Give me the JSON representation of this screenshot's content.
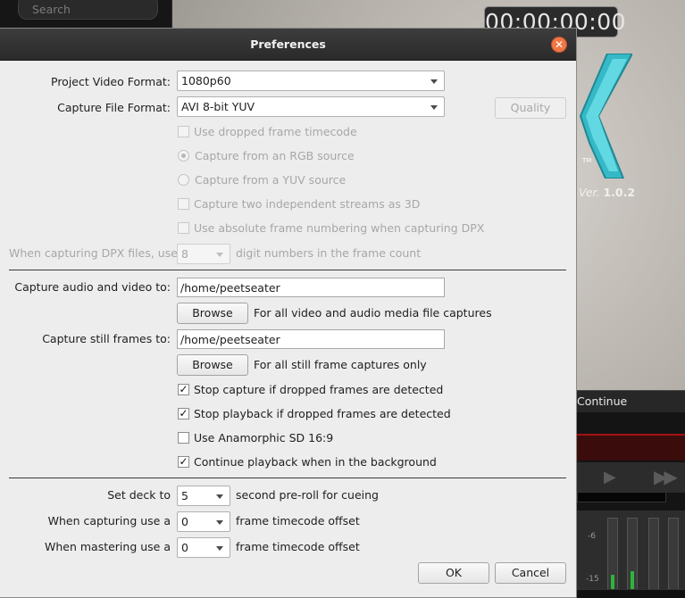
{
  "background": {
    "search_placeholder": "Search",
    "timecode": "00:00:00:00",
    "version_prefix": "Ver.",
    "version_number": "1.0.2",
    "continue_label": "Continue",
    "meter_labels": [
      "-6",
      "-15"
    ],
    "accent": "#a41313",
    "meter_fill_levels": [
      0.28,
      0.33
    ]
  },
  "dialog": {
    "title": "Preferences",
    "close_icon": "close-icon",
    "accent": "#f07746",
    "project_video_format": {
      "label": "Project Video Format:",
      "value": "1080p60"
    },
    "capture_file_format": {
      "label": "Capture File Format:",
      "value": "AVI 8-bit YUV"
    },
    "quality_button": "Quality",
    "capture_options": [
      {
        "type": "checkbox",
        "label": "Use dropped frame timecode",
        "checked": false,
        "enabled": false
      },
      {
        "type": "radio",
        "label": "Capture from an RGB source",
        "checked": true,
        "enabled": false
      },
      {
        "type": "radio",
        "label": "Capture from a YUV source",
        "checked": false,
        "enabled": false
      },
      {
        "type": "checkbox",
        "label": "Capture two independent streams as 3D",
        "checked": false,
        "enabled": false
      },
      {
        "type": "checkbox",
        "label": "Use absolute frame numbering when capturing DPX",
        "checked": false,
        "enabled": false
      }
    ],
    "dpx_digits": {
      "label": "When capturing DPX files, use",
      "value": "8",
      "suffix": "digit numbers in the frame count"
    },
    "capture_av": {
      "label": "Capture audio and video to:",
      "value": "/home/peetseater",
      "browse": "Browse",
      "hint": "For all video and audio media file captures"
    },
    "capture_still": {
      "label": "Capture still frames to:",
      "value": "/home/peetseater",
      "browse": "Browse",
      "hint": "For all still frame captures only"
    },
    "general_options": [
      {
        "label": "Stop capture if dropped frames are detected",
        "checked": true
      },
      {
        "label": "Stop playback if dropped frames are detected",
        "checked": true
      },
      {
        "label": "Use Anamorphic SD 16:9",
        "checked": false
      },
      {
        "label": "Continue playback when in the background",
        "checked": true
      }
    ],
    "preroll": {
      "label": "Set deck to",
      "value": "5",
      "suffix": "second pre-roll for cueing"
    },
    "capture_offset": {
      "label": "When capturing use a",
      "value": "0",
      "suffix": "frame timecode offset"
    },
    "master_offset": {
      "label": "When mastering use a",
      "value": "0",
      "suffix": "frame timecode offset"
    },
    "ok": "OK",
    "cancel": "Cancel"
  }
}
